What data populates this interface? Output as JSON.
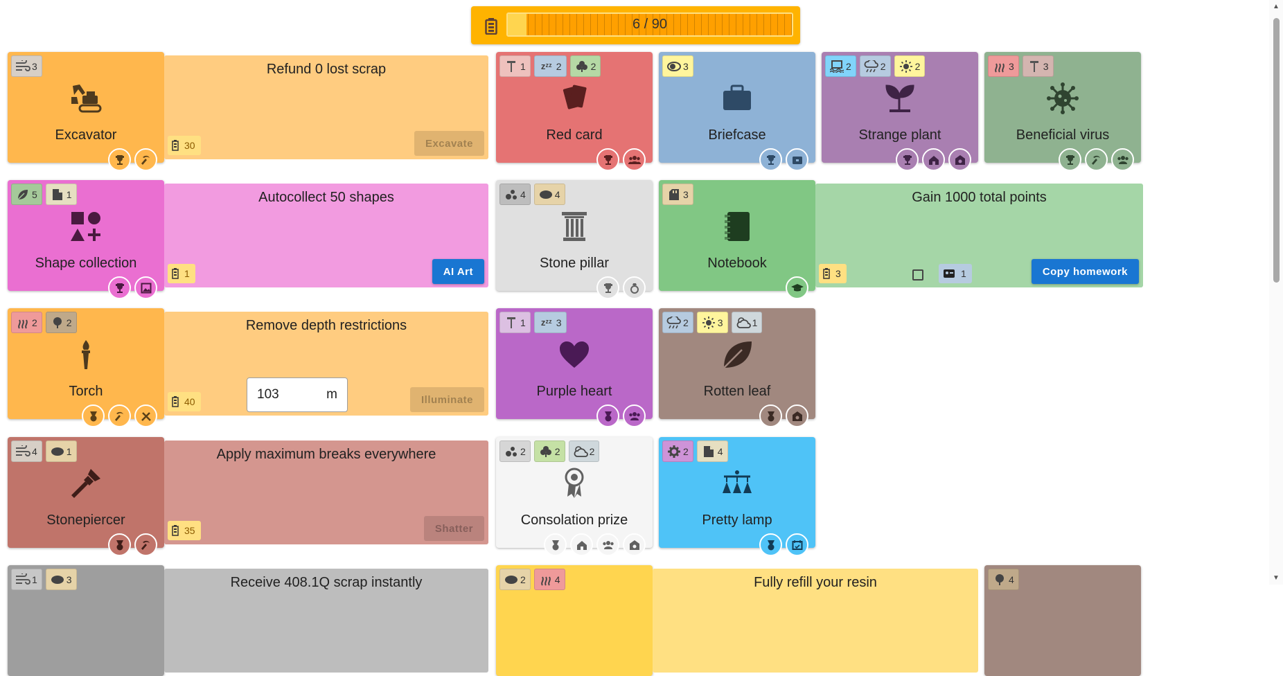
{
  "resource_bar": {
    "text": "6 / 90",
    "fill_fraction": 0.067
  },
  "row1": {
    "excavator": {
      "badge1": "3",
      "title": "Excavator"
    },
    "panel": {
      "title": "Refund 0 lost scrap",
      "cost": "30",
      "button": "Excavate"
    },
    "red_card": {
      "badge1": "1",
      "badge2": "2",
      "badge3": "2",
      "title": "Red card"
    },
    "briefcase": {
      "badge1": "3",
      "title": "Briefcase"
    },
    "strange_plant": {
      "badge1": "2",
      "badge2": "2",
      "badge3": "2",
      "title": "Strange plant"
    },
    "beneficial_virus": {
      "badge1": "3",
      "badge2": "3",
      "title": "Beneficial virus"
    }
  },
  "row2": {
    "shape_collection": {
      "badge1": "5",
      "badge2": "1",
      "title": "Shape collection"
    },
    "panel": {
      "title": "Autocollect 50 shapes",
      "cost": "1",
      "button": "AI Art"
    },
    "stone_pillar": {
      "badge1": "4",
      "badge2": "4",
      "title": "Stone pillar"
    },
    "notebook": {
      "badge1": "3",
      "title": "Notebook"
    },
    "panel2": {
      "title": "Gain 1000 total points",
      "cost": "3",
      "ticket": "1",
      "button": "Copy homework"
    }
  },
  "row3": {
    "torch": {
      "badge1": "2",
      "badge2": "2",
      "title": "Torch"
    },
    "panel": {
      "title": "Remove depth restrictions",
      "cost": "40",
      "depth_value": "103",
      "depth_unit": "m",
      "button": "Illuminate"
    },
    "purple_heart": {
      "badge1": "1",
      "badge2": "3",
      "title": "Purple heart"
    },
    "rotten_leaf": {
      "badge1": "2",
      "badge2": "3",
      "badge3": "1",
      "title": "Rotten leaf"
    }
  },
  "row4": {
    "stonepiercer": {
      "badge1": "4",
      "badge2": "1",
      "title": "Stonepiercer"
    },
    "panel": {
      "title": "Apply maximum breaks everywhere",
      "cost": "35",
      "button": "Shatter"
    },
    "consolation_prize": {
      "badge1": "2",
      "badge2": "2",
      "badge3": "2",
      "title": "Consolation prize"
    },
    "pretty_lamp": {
      "badge1": "2",
      "badge2": "4",
      "title": "Pretty lamp"
    }
  },
  "row5": {
    "card1": {
      "badge1": "1",
      "badge2": "3"
    },
    "panel": {
      "title": "Receive 408.1Q scrap instantly"
    },
    "card2": {
      "badge1": "2",
      "badge2": "4"
    },
    "panel2": {
      "title": "Fully refill your resin"
    },
    "card3": {
      "badge1": "4"
    }
  },
  "colors": {
    "orange": "#ffb74d",
    "orange_panel": "#ffcc80",
    "red": "#e57373",
    "blue": "#8eb2d6",
    "purple": "#a97fb1",
    "green_gray": "#8fb290",
    "pink": "#ea6fd1",
    "pink_panel": "#f29be0",
    "light_gray": "#e0e0e0",
    "green": "#81c784",
    "green_panel": "#a5d6a7",
    "violet": "#ba68c8",
    "brown": "#a1887f",
    "brick": "#c0746a",
    "brick_panel": "#d4968f",
    "white": "#f5f5f5",
    "sky": "#4fc3f7",
    "gray": "#9e9e9e",
    "yellow": "#ffd54f",
    "yellow_panel": "#ffe082",
    "button_blue": "#1976d2"
  }
}
